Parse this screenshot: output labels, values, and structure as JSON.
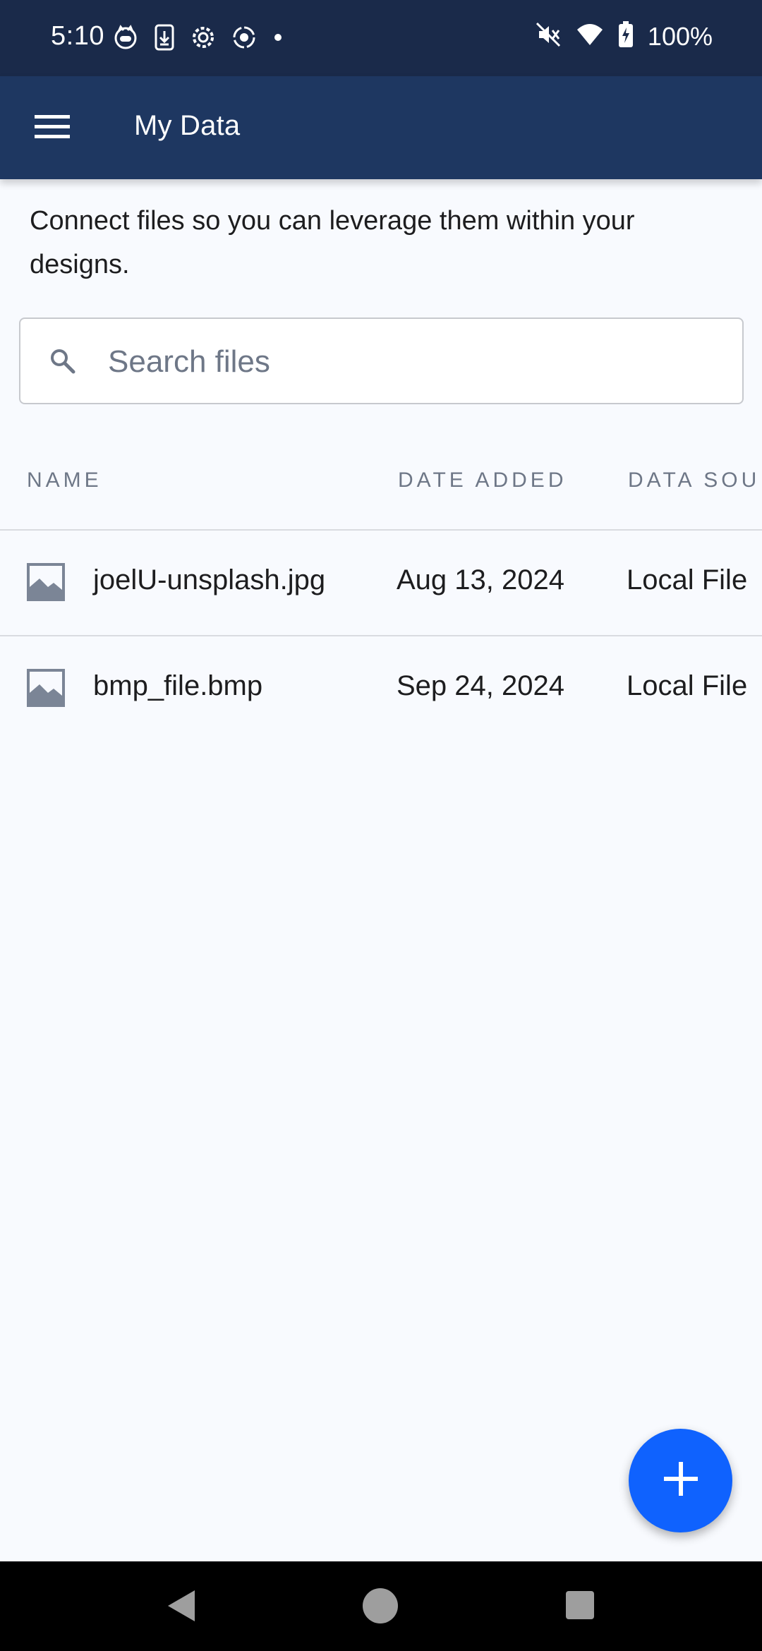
{
  "status_bar": {
    "time": "5:10",
    "battery": "100%",
    "icons_left": [
      "cat-face-icon",
      "download-icon",
      "settings-icon",
      "record-icon",
      "dot-icon"
    ],
    "icons_right": [
      "mute-icon",
      "wifi-icon",
      "battery-charging-icon"
    ]
  },
  "app_bar": {
    "title": "My Data",
    "menu_icon": "hamburger-menu-icon"
  },
  "description": "Connect files so you can leverage them within your designs.",
  "search": {
    "placeholder": "Search files",
    "value": ""
  },
  "table": {
    "columns": [
      "NAME",
      "DATE ADDED",
      "DATA SOU"
    ],
    "rows": [
      {
        "name": "joelU-unsplash.jpg",
        "date": "Aug 13, 2024",
        "source": "Local File",
        "icon": "image-file-icon"
      },
      {
        "name": "bmp_file.bmp",
        "date": "Sep 24, 2024",
        "source": "Local File",
        "icon": "image-file-icon"
      }
    ]
  },
  "fab": {
    "icon": "plus-icon"
  },
  "colors": {
    "status_bar_bg": "#1a2a4a",
    "app_bar_bg": "#1e3761",
    "page_bg": "#f8fafe",
    "accent": "#0f62fe",
    "muted_text": "#6e7787"
  }
}
